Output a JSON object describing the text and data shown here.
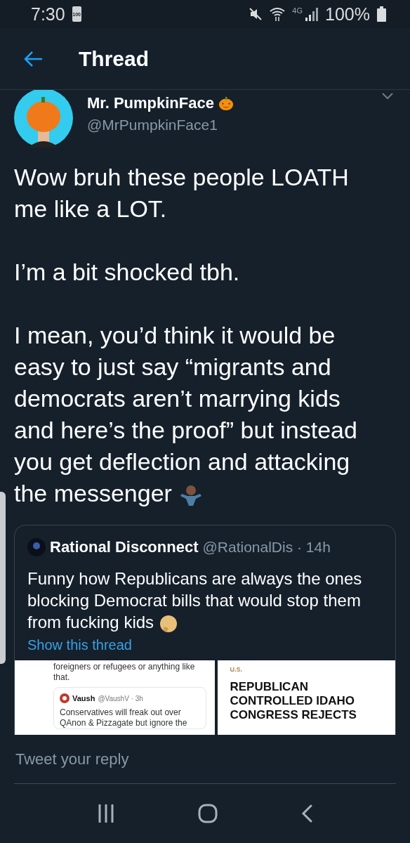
{
  "status_bar": {
    "time": "7:30",
    "battery_badge": "100",
    "network": "4G",
    "battery": "100%"
  },
  "header": {
    "title": "Thread"
  },
  "tweet": {
    "name": "Mr. PumpkinFace",
    "handle": "@MrPumpkinFace1",
    "paragraphs": [
      [
        "Wow bruh these people LOATH",
        "me like a LOT."
      ],
      [
        "I’m a bit shocked tbh."
      ],
      [
        "I mean, you’d think it would be",
        "easy to just say “migrants and",
        "democrats aren’t marrying kids",
        "and here’s the proof” but instead",
        "you get deflection and attacking",
        "the messenger"
      ]
    ],
    "quote": {
      "name": "Rational Disconnect",
      "handle": "@RationalDis · 14h",
      "lines": [
        "Funny how Republicans are always the ones",
        "blocking Democrat bills that would stop them",
        "from fucking kids"
      ],
      "link": "Show this thread",
      "media_left": {
        "text": [
          "foreigners or refugees or anything like",
          "that."
        ],
        "inner_name": "Vaush",
        "inner_meta": "@VaushV · 3h",
        "inner_text": [
          "Conservatives will freak out over",
          "QAnon & Pizzagate but ignore the"
        ]
      },
      "media_right": {
        "section": "U.S.",
        "headline": [
          "REPUBLICAN",
          "CONTROLLED IDAHO",
          "CONGRESS REJECTS"
        ]
      }
    }
  },
  "reply": {
    "placeholder": "Tweet your reply"
  }
}
